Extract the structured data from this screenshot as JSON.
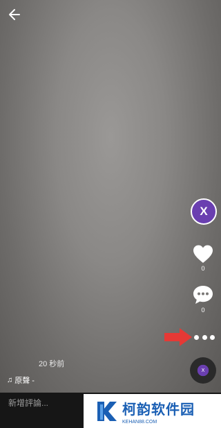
{
  "header": {
    "back_icon": "arrow-left-icon"
  },
  "creator": {
    "avatar_letter": "X"
  },
  "actions": {
    "like_count": "0",
    "comment_count": "0"
  },
  "video_info": {
    "timestamp": "20 秒前",
    "sound_label": "原聲 -",
    "disc_letter": "X"
  },
  "comment_input": {
    "placeholder": "新增評論..."
  },
  "watermark": {
    "title": "柯韵软件园",
    "url": "KEHAN88.COM"
  },
  "colors": {
    "accent": "#6a3fb0",
    "arrow": "#e53935",
    "watermark": "#1a5fb4"
  }
}
